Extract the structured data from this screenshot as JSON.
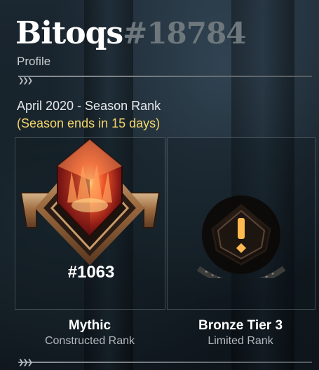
{
  "header": {
    "username": "Bitoqs",
    "tag": "#18784",
    "subtitle": "Profile"
  },
  "season": {
    "title": "April 2020 - Season Rank",
    "ends": "(Season ends in 15 days)"
  },
  "ranks": [
    {
      "badge_icon": "mythic-rank-icon",
      "rank_number": "#1063",
      "name": "Mythic",
      "format": "Constructed Rank"
    },
    {
      "badge_icon": "bronze-rank-icon",
      "name": "Bronze Tier 3",
      "format": "Limited Rank"
    }
  ]
}
